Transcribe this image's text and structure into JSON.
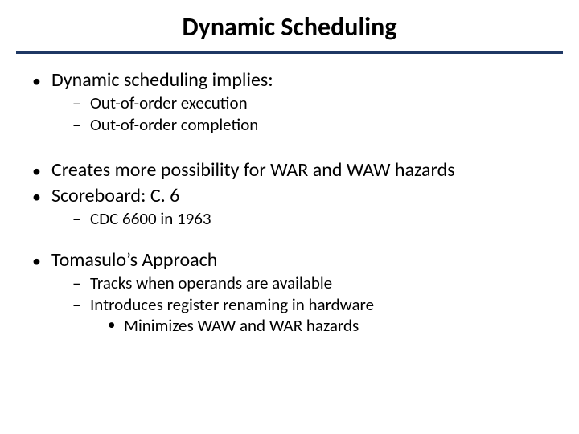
{
  "title": "Dynamic Scheduling",
  "bullets": {
    "b1": {
      "text": "Dynamic scheduling implies:",
      "sub": [
        "Out-of-order execution",
        "Out-of-order completion"
      ]
    },
    "b2": {
      "text": "Creates more possibility for WAR and WAW hazards"
    },
    "b3": {
      "text": "Scoreboard: C. 6",
      "sub": [
        "CDC 6600 in 1963"
      ]
    },
    "b4": {
      "text": "Tomasulo’s Approach",
      "sub": [
        "Tracks when operands are available",
        "Introduces register renaming in hardware"
      ],
      "subsub": [
        "Minimizes WAW and WAR hazards"
      ]
    }
  }
}
